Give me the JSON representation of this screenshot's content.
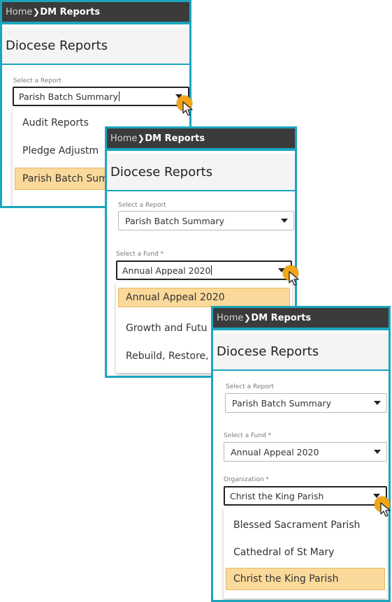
{
  "breadcrumb": {
    "home": "Home",
    "current": "DM Reports"
  },
  "page_title": "Diocese Reports",
  "fields": {
    "report": {
      "label": "Select a Report",
      "value": "Parish Batch Summary"
    },
    "fund": {
      "label": "Select a Fund *",
      "value": "Annual Appeal 2020"
    },
    "organization": {
      "label": "Organization *",
      "value": "Christ the King Parish"
    }
  },
  "dropdowns": {
    "report_options": [
      "Audit Reports",
      "Pledge Adjustm",
      "Parish Batch Sum"
    ],
    "fund_options": [
      "Annual Appeal 2020",
      "Growth and Futu",
      "Rebuild, Restore,"
    ],
    "organization_options": [
      "Blessed Sacrament Parish",
      "Cathedral of St Mary",
      "Christ the King Parish"
    ]
  },
  "colors": {
    "frame_accent": "#1ba5bd",
    "header_bar": "#3b3b3b",
    "selected_option": "#fbd99a",
    "pointer_highlight": "#f2a516"
  },
  "icons": {
    "breadcrumb_separator": "chevron-right-icon",
    "dropdown": "caret-down-icon",
    "pointer": "mouse-pointer-icon"
  }
}
